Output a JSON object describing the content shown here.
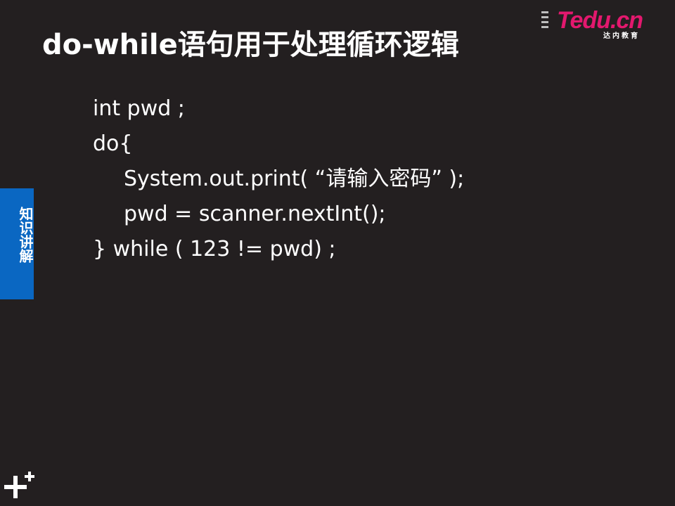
{
  "slide": {
    "title": "do-while语句用于处理循环逻辑",
    "logo_text": "Tedu.cn",
    "logo_subtext": "达内教育",
    "side_tab_label": "知识讲解",
    "code_lines": [
      "int pwd ;",
      "do{",
      "System.out.print( “请输入密码” );",
      "pwd = scanner.nextInt();",
      "} while ( 123 != pwd) ;"
    ]
  },
  "colors": {
    "background": "#231f20",
    "side_tab": "#0a67c2",
    "logo_accent": "#e3186e",
    "text": "#ffffff"
  },
  "icons": {
    "corner_decoration": "plus-icon",
    "header_decoration": "dash-lines-icon"
  }
}
